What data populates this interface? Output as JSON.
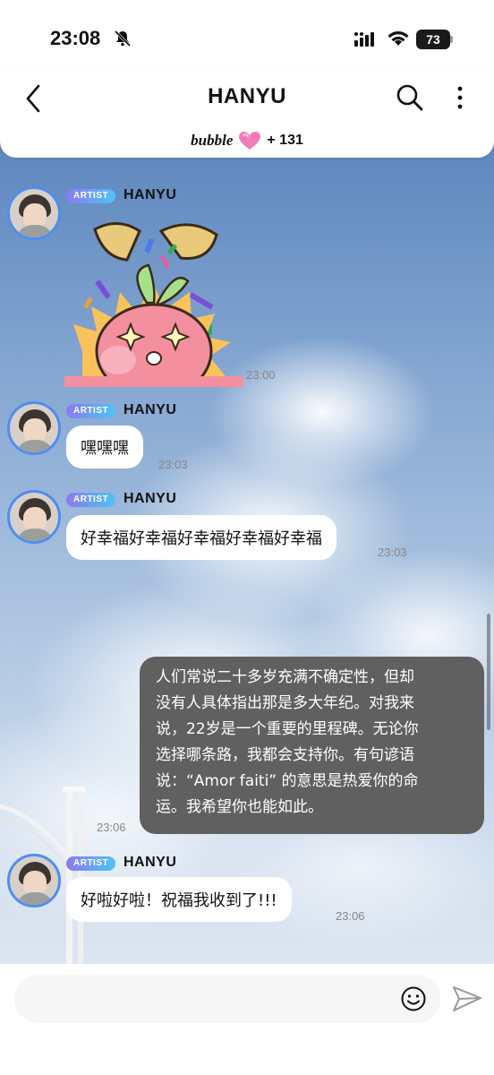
{
  "status_bar": {
    "time": "23:08",
    "battery": "73"
  },
  "header": {
    "title": "HANYU",
    "bubble_logo": "bubble",
    "bubble_count": "+ 131"
  },
  "messages": [
    {
      "badge": "ARTIST",
      "sender": "HANYU",
      "type": "sticker",
      "time": "23:00"
    },
    {
      "badge": "ARTIST",
      "sender": "HANYU",
      "text": "嘿嘿嘿",
      "time": "23:03"
    },
    {
      "badge": "ARTIST",
      "sender": "HANYU",
      "text": "好幸福好幸福好幸福好幸福好幸福",
      "time": "23:03"
    },
    {
      "mine": true,
      "text": "人们常说二十多岁充满不确定性，但却\n没有人具体指出那是多大年纪。对我来\n说，22岁是一个重要的里程碑。无论你\n选择哪条路，我都会支持你。有句谚语\n说：“Amor faiti” 的意思是热爱你的命\n运。我希望你也能如此。",
      "time": "23:06"
    },
    {
      "badge": "ARTIST",
      "sender": "HANYU",
      "text": "好啦好啦！祝福我收到了!!!",
      "time": "23:06"
    }
  ],
  "input": {
    "value": "",
    "placeholder": ""
  },
  "colors": {
    "artist_badge_start": "#8a7bf0",
    "artist_badge_end": "#4ec3f5",
    "my_bubble": "#606060",
    "avatar_ring": "#4e8ef0",
    "heart": "#f27bb8"
  },
  "icons": [
    "mute-bell-icon",
    "signal-icon",
    "wifi-icon",
    "back-icon",
    "search-icon",
    "more-icon",
    "heart-icon",
    "emoji-icon",
    "send-icon"
  ]
}
